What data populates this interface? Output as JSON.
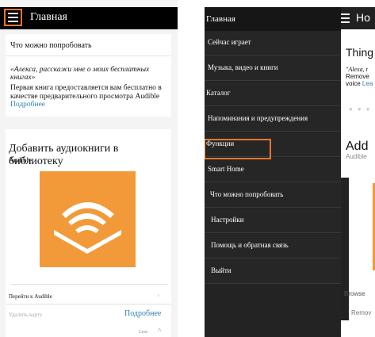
{
  "left": {
    "header": {
      "title": "Главная"
    },
    "try_card": {
      "title": "Что можно попробовать",
      "quote": "«Алекса, расскажи мне о моих бесплатных книгах»",
      "body": "Первая книга предоставляется вам бесплатно в качестве предварительного просмотра Audible",
      "link": "Подробнее"
    },
    "audible_card": {
      "title": "Добавить аудиокниги в библиотеку",
      "subtitle": "Audible",
      "go_label": "Перейти к Audible",
      "delete_label": "Удалить карту",
      "more_label": "Подробнее",
      "less_label": "Less"
    }
  },
  "right": {
    "behind": {
      "header_title_partial": "Ho",
      "things_partial": "Thing",
      "quote_partial": "\"Alexa, t",
      "remove_partial": "Remove",
      "voice_partial": "voice",
      "learn_partial": "Lea",
      "add_partial": "Add",
      "audible_partial": "Audible",
      "browse_partial": "Browse",
      "remove2_partial": "Remov"
    },
    "drawer": {
      "header": "Главная",
      "items": [
        {
          "label": "Сейчас играет"
        },
        {
          "label": "Музыка, видео и книги"
        },
        {
          "label": "Каталог"
        },
        {
          "label": "Напоминания и предупреждения"
        },
        {
          "label": "Функции"
        },
        {
          "label": "Smart Home"
        },
        {
          "label": "Что можно попробовать"
        },
        {
          "label": "Настройки"
        },
        {
          "label": "Помощь и обратная связь"
        },
        {
          "label": "Выйти"
        }
      ]
    }
  },
  "colors": {
    "highlight": "#e8742c",
    "audible_orange": "#f29a39",
    "link": "#2b7fb8"
  }
}
